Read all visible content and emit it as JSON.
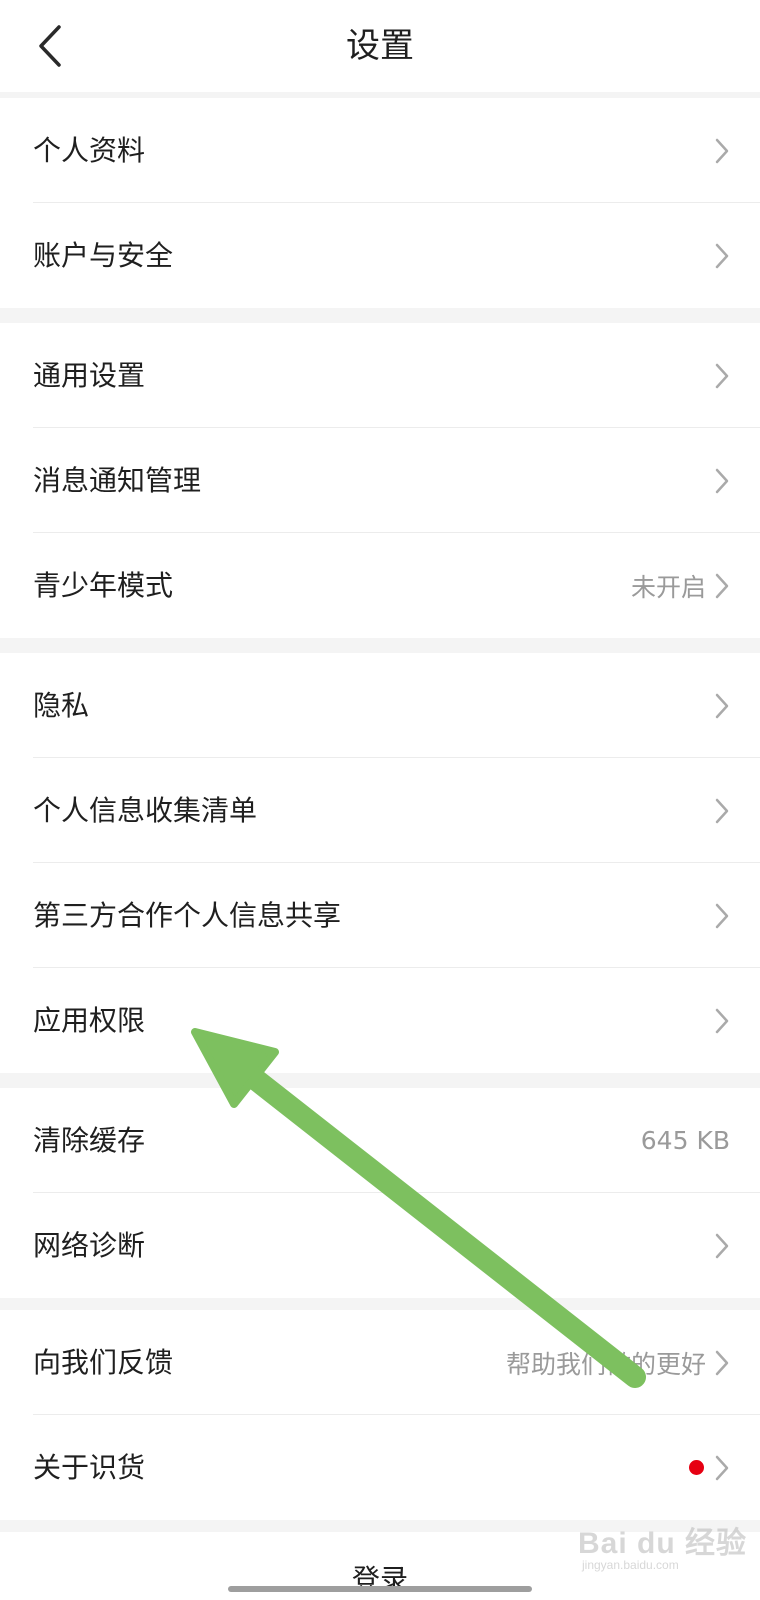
{
  "header": {
    "title": "设置"
  },
  "groups": [
    {
      "items": [
        {
          "label": "个人资料",
          "value": ""
        },
        {
          "label": "账户与安全",
          "value": ""
        }
      ]
    },
    {
      "items": [
        {
          "label": "通用设置",
          "value": ""
        },
        {
          "label": "消息通知管理",
          "value": ""
        },
        {
          "label": "青少年模式",
          "value": "未开启"
        }
      ]
    },
    {
      "items": [
        {
          "label": "隐私",
          "value": ""
        },
        {
          "label": "个人信息收集清单",
          "value": ""
        },
        {
          "label": "第三方合作个人信息共享",
          "value": ""
        },
        {
          "label": "应用权限",
          "value": ""
        }
      ]
    },
    {
      "items": [
        {
          "label": "清除缓存",
          "value": "645 KB"
        },
        {
          "label": "网络诊断",
          "value": ""
        }
      ]
    },
    {
      "items": [
        {
          "label": "向我们反馈",
          "value": "帮助我们做的更好"
        },
        {
          "label": "关于识货",
          "value": ""
        }
      ]
    }
  ],
  "footer": {
    "login_label": "登录"
  },
  "watermark": {
    "main": "Bai du 经验",
    "sub": "jingyan.baidu.com"
  },
  "colors": {
    "annotation_arrow": "#7dc05f",
    "red_dot": "#e60012",
    "background": "#f4f4f4"
  }
}
